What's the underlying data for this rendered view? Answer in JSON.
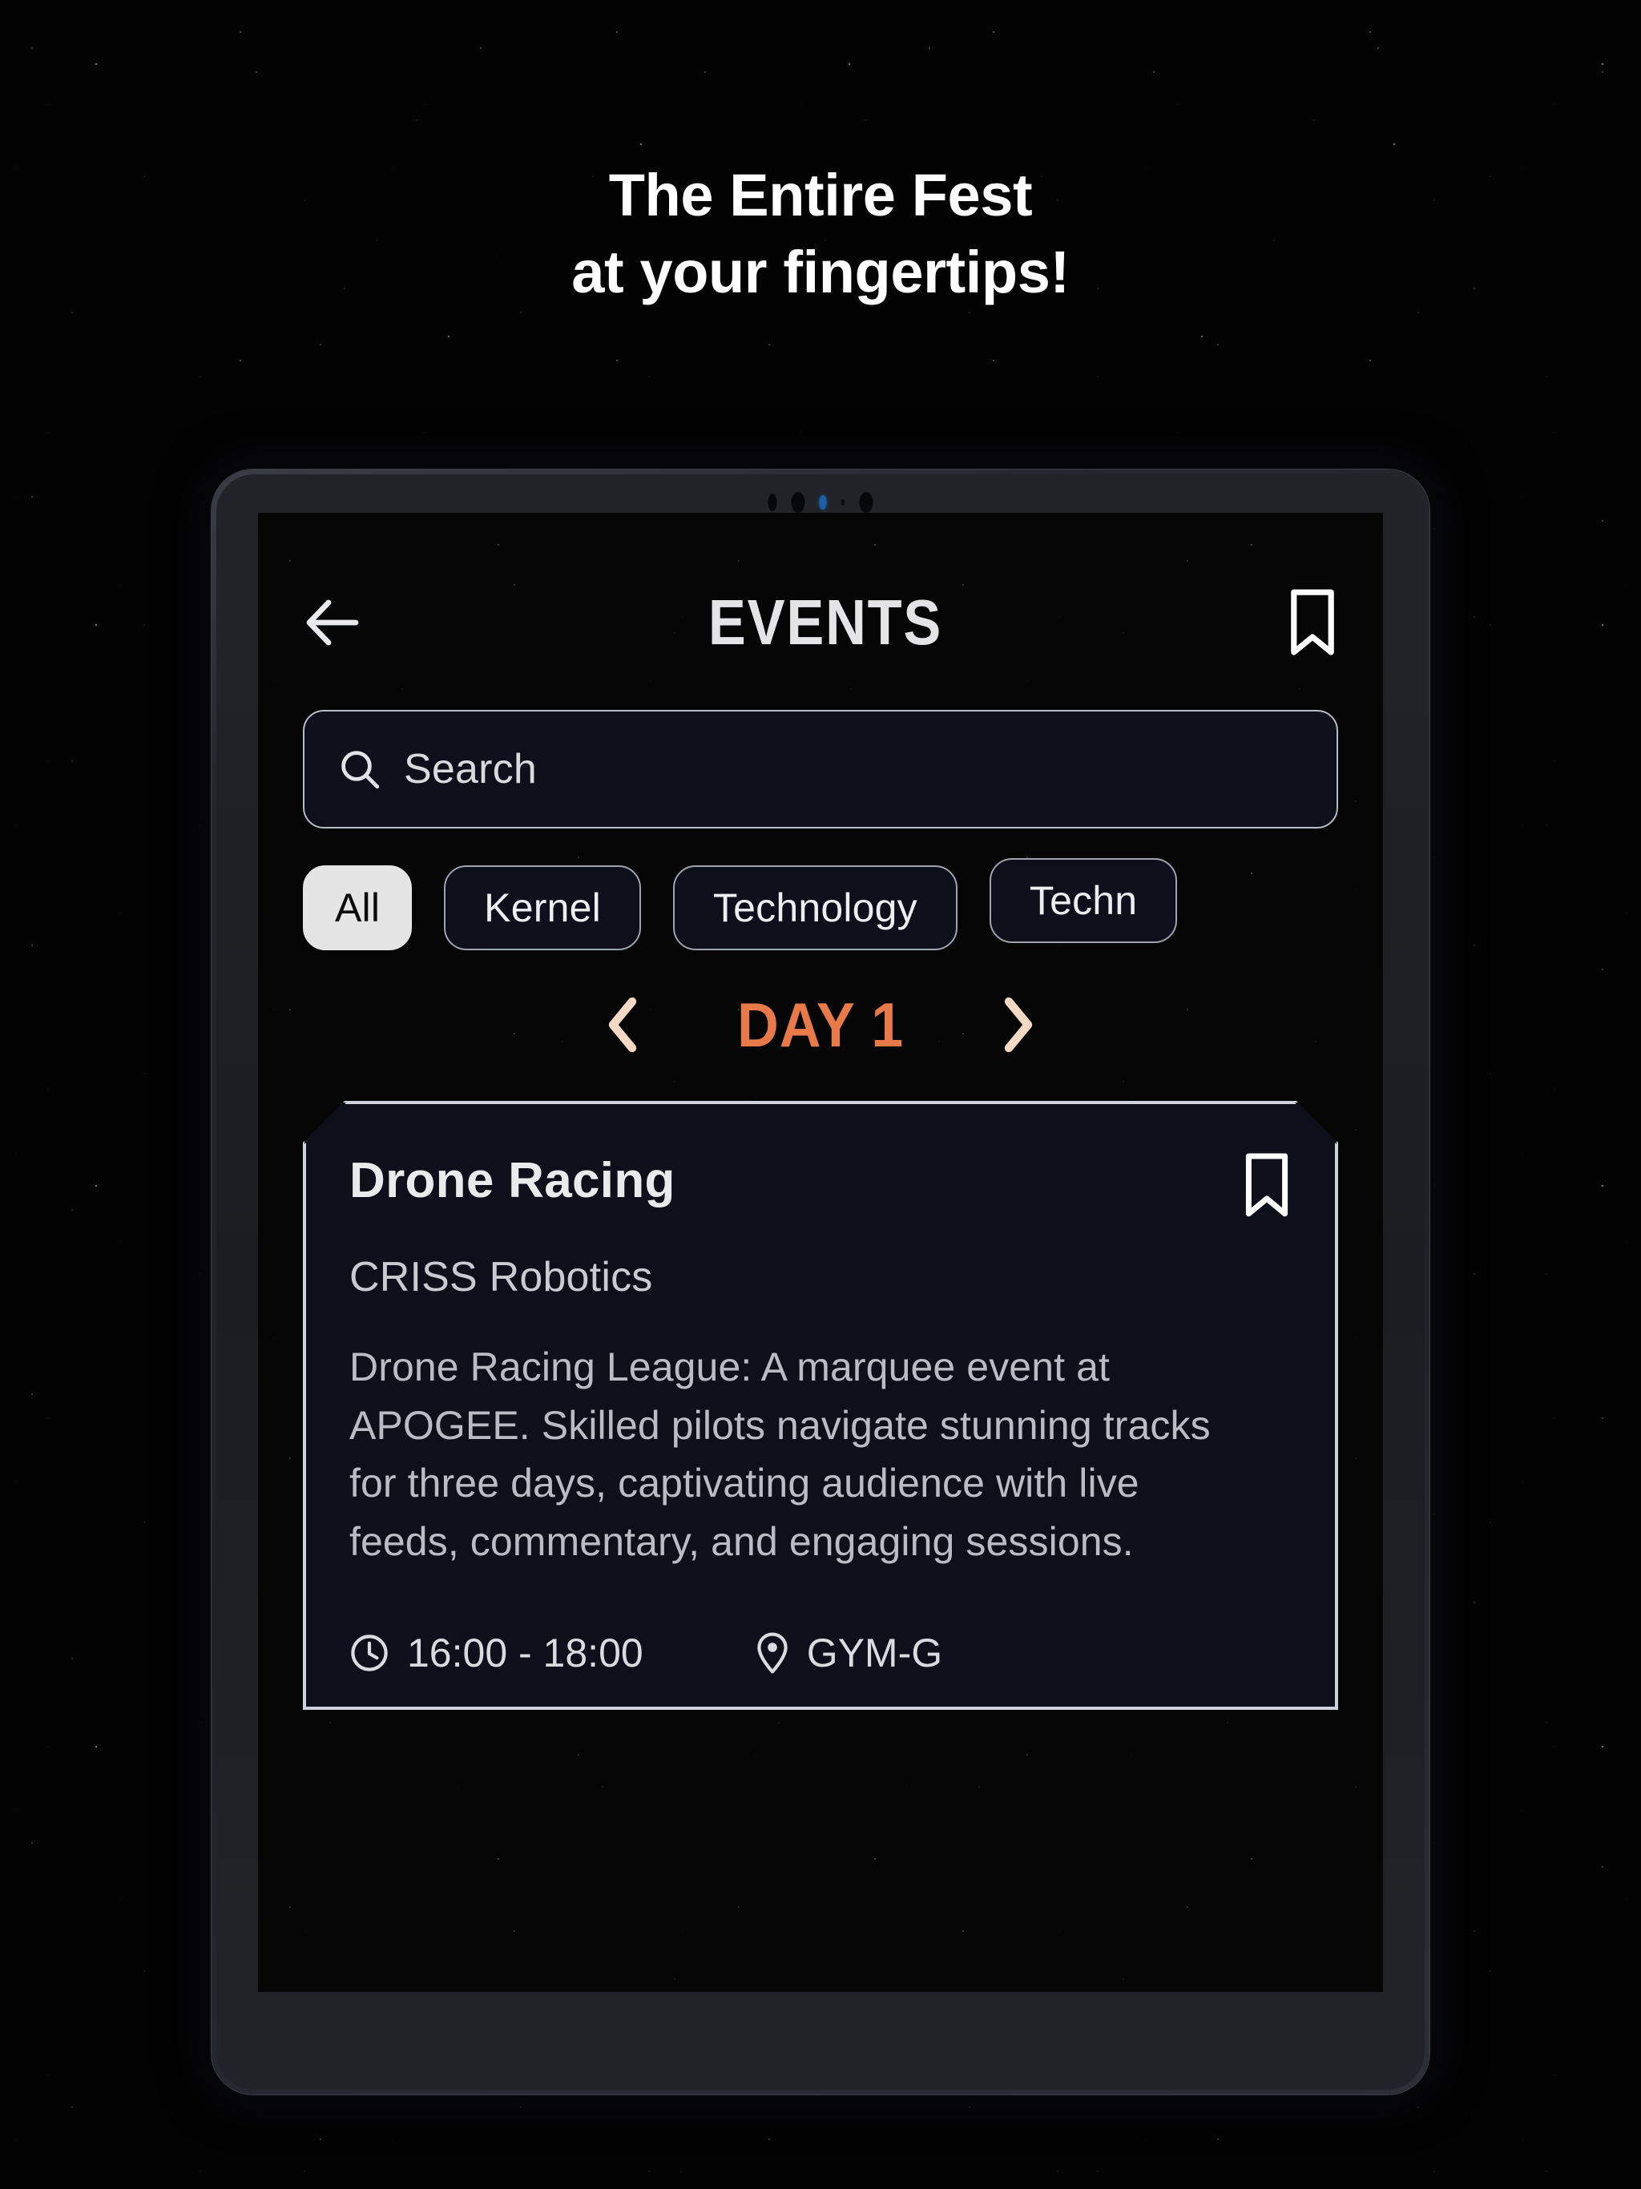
{
  "promo": {
    "headline_line1": "The Entire Fest",
    "headline_line2": "at your fingertips!"
  },
  "colors": {
    "accent_orange": "#e87a49",
    "chevron_peach": "#f6d9c5",
    "card_bg": "#0d0f1a",
    "chip_border": "#9fa3ae",
    "screen_bg": "#050506"
  },
  "app": {
    "header": {
      "back_icon": "arrow-left-icon",
      "title": "EVENTS",
      "bookmark_icon": "bookmark-icon"
    },
    "search": {
      "icon": "search-icon",
      "placeholder": "Search",
      "value": ""
    },
    "filters": {
      "selected": "All",
      "chips": [
        {
          "label": "All",
          "selected": true
        },
        {
          "label": "Kernel",
          "selected": false
        },
        {
          "label": "Technology",
          "selected": false
        },
        {
          "label": "Techn",
          "selected": false,
          "clipped": true
        }
      ]
    },
    "day_selector": {
      "prev_icon": "chevron-left-icon",
      "label": "DAY 1",
      "next_icon": "chevron-right-icon"
    },
    "events": [
      {
        "title": "Drone Racing",
        "organizer": "CRISS Robotics",
        "description": "Drone Racing League: A marquee event at APOGEE. Skilled pilots navigate stunning tracks for three days, captivating audience with live feeds, commentary, and engaging sessions.",
        "time_icon": "clock-icon",
        "time": "16:00 - 18:00",
        "location_icon": "map-pin-icon",
        "location": "GYM-G",
        "bookmark_icon": "bookmark-icon"
      }
    ]
  }
}
